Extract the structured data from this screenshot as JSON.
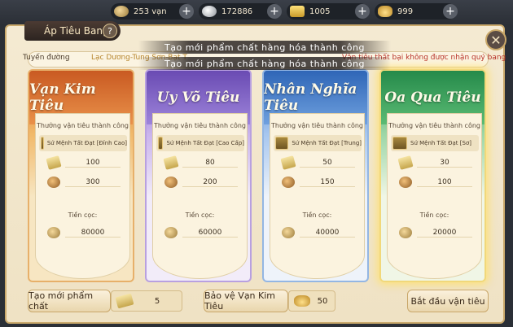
{
  "resources": [
    {
      "icon": "copper-coin-icon",
      "value": "253 vạn"
    },
    {
      "icon": "silver-coin-icon",
      "value": "172886"
    },
    {
      "icon": "gold-bar-icon",
      "value": "1005"
    },
    {
      "icon": "gold-ingot-icon",
      "value": "999"
    }
  ],
  "panel": {
    "title": "Áp Tiêu Bang",
    "help_label": "?",
    "close_label": "✕"
  },
  "route": {
    "label": "Tuyến đường",
    "value": "Lạc Dương-Tung Sơn-Bạt T",
    "warning": "Vận tiêu thất bại không được nhận quý bang"
  },
  "toasts": [
    "Tạo mới phẩm chất hàng hóa thành công",
    "Tạo mới phẩm chất hàng hóa thành công"
  ],
  "cards": [
    {
      "title": "Vạn Kim Tiêu",
      "reward_label": "Thưởng vận tiêu thành công",
      "item_name": "Sứ Mệnh Tất Đạt [Đỉnh Cao]",
      "ticket_value": "100",
      "copper_value": "300",
      "deposit_label": "Tiền cọc:",
      "deposit_value": "80000"
    },
    {
      "title": "Uy Võ Tiêu",
      "reward_label": "Thưởng vận tiêu thành công",
      "item_name": "Sứ Mệnh Tất Đạt [Cao Cấp]",
      "ticket_value": "80",
      "copper_value": "200",
      "deposit_label": "Tiền cọc:",
      "deposit_value": "60000"
    },
    {
      "title": "Nhân Nghĩa Tiêu",
      "reward_label": "Thưởng vận tiêu thành công",
      "item_name": "Sứ Mệnh Tất Đạt [Trung]",
      "ticket_value": "50",
      "copper_value": "150",
      "deposit_label": "Tiền cọc:",
      "deposit_value": "40000"
    },
    {
      "title": "Oa Qua Tiêu",
      "reward_label": "Thưởng vận tiêu thành công",
      "item_name": "Sứ Mệnh Tất Đạt [Sơ]",
      "ticket_value": "30",
      "copper_value": "100",
      "deposit_label": "Tiền cọc:",
      "deposit_value": "20000"
    }
  ],
  "bottom": {
    "refresh_label": "Tạo mới phẩm chất",
    "refresh_cost": "5",
    "protect_label": "Bảo vệ Vạn Kim Tiêu",
    "protect_cost": "50",
    "start_label": "Bắt đầu vận tiêu"
  },
  "colors": {
    "card_orange": "#d96b2a",
    "card_purple": "#7d5cc4",
    "card_blue": "#3a74c6",
    "card_green": "#2c9a57",
    "selected_glow": "#f1d87a",
    "warning_red": "#b8322a"
  }
}
